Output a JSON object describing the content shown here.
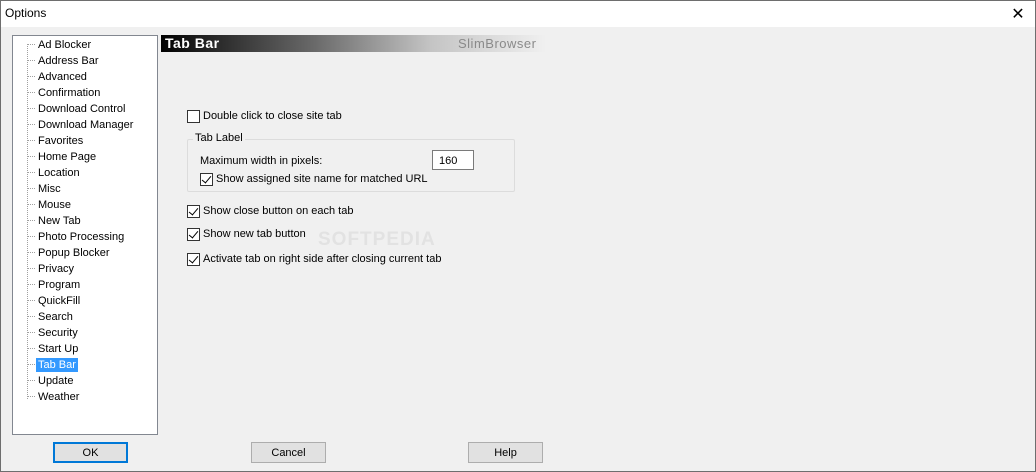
{
  "window": {
    "title": "Options",
    "close_glyph": "✕"
  },
  "tree": {
    "items": [
      {
        "label": "Ad Blocker"
      },
      {
        "label": "Address Bar"
      },
      {
        "label": "Advanced"
      },
      {
        "label": "Confirmation"
      },
      {
        "label": "Download Control"
      },
      {
        "label": "Download Manager"
      },
      {
        "label": "Favorites"
      },
      {
        "label": "Home Page"
      },
      {
        "label": "Location"
      },
      {
        "label": "Misc"
      },
      {
        "label": "Mouse"
      },
      {
        "label": "New Tab"
      },
      {
        "label": "Photo Processing"
      },
      {
        "label": "Popup Blocker"
      },
      {
        "label": "Privacy"
      },
      {
        "label": "Program"
      },
      {
        "label": "QuickFill"
      },
      {
        "label": "Search"
      },
      {
        "label": "Security"
      },
      {
        "label": "Start Up"
      },
      {
        "label": "Tab Bar"
      },
      {
        "label": "Update"
      },
      {
        "label": "Weather"
      }
    ],
    "selected": "Tab Bar"
  },
  "banner": {
    "title": "Tab Bar",
    "brand": "SlimBrowser"
  },
  "settings": {
    "double_click_close": {
      "label": "Double click to close site tab",
      "checked": false
    },
    "tab_label_group": "Tab Label",
    "max_width_label": "Maximum width in pixels:",
    "max_width_value": "160",
    "show_site_name": {
      "label": "Show assigned site name for matched URL",
      "checked": true
    },
    "show_close_button": {
      "label": "Show close button on each tab",
      "checked": true
    },
    "show_new_tab_button": {
      "label": "Show new tab button",
      "checked": true
    },
    "activate_right": {
      "label": "Activate tab on right side after closing current tab",
      "checked": true
    }
  },
  "watermark": "SOFTPEDIA",
  "buttons": {
    "ok": "OK",
    "cancel": "Cancel",
    "help": "Help"
  },
  "colors": {
    "selection": "#3399ff",
    "default_button_border": "#0078d7"
  }
}
